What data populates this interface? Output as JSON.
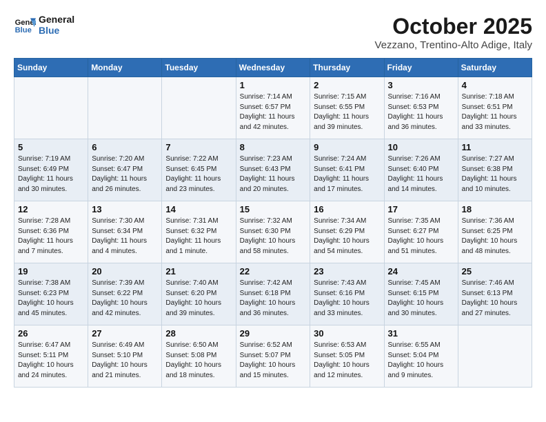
{
  "header": {
    "logo_line1": "General",
    "logo_line2": "Blue",
    "title": "October 2025",
    "subtitle": "Vezzano, Trentino-Alto Adige, Italy"
  },
  "days_of_week": [
    "Sunday",
    "Monday",
    "Tuesday",
    "Wednesday",
    "Thursday",
    "Friday",
    "Saturday"
  ],
  "weeks": [
    [
      {
        "num": "",
        "info": ""
      },
      {
        "num": "",
        "info": ""
      },
      {
        "num": "",
        "info": ""
      },
      {
        "num": "1",
        "info": "Sunrise: 7:14 AM\nSunset: 6:57 PM\nDaylight: 11 hours and 42 minutes."
      },
      {
        "num": "2",
        "info": "Sunrise: 7:15 AM\nSunset: 6:55 PM\nDaylight: 11 hours and 39 minutes."
      },
      {
        "num": "3",
        "info": "Sunrise: 7:16 AM\nSunset: 6:53 PM\nDaylight: 11 hours and 36 minutes."
      },
      {
        "num": "4",
        "info": "Sunrise: 7:18 AM\nSunset: 6:51 PM\nDaylight: 11 hours and 33 minutes."
      }
    ],
    [
      {
        "num": "5",
        "info": "Sunrise: 7:19 AM\nSunset: 6:49 PM\nDaylight: 11 hours and 30 minutes."
      },
      {
        "num": "6",
        "info": "Sunrise: 7:20 AM\nSunset: 6:47 PM\nDaylight: 11 hours and 26 minutes."
      },
      {
        "num": "7",
        "info": "Sunrise: 7:22 AM\nSunset: 6:45 PM\nDaylight: 11 hours and 23 minutes."
      },
      {
        "num": "8",
        "info": "Sunrise: 7:23 AM\nSunset: 6:43 PM\nDaylight: 11 hours and 20 minutes."
      },
      {
        "num": "9",
        "info": "Sunrise: 7:24 AM\nSunset: 6:41 PM\nDaylight: 11 hours and 17 minutes."
      },
      {
        "num": "10",
        "info": "Sunrise: 7:26 AM\nSunset: 6:40 PM\nDaylight: 11 hours and 14 minutes."
      },
      {
        "num": "11",
        "info": "Sunrise: 7:27 AM\nSunset: 6:38 PM\nDaylight: 11 hours and 10 minutes."
      }
    ],
    [
      {
        "num": "12",
        "info": "Sunrise: 7:28 AM\nSunset: 6:36 PM\nDaylight: 11 hours and 7 minutes."
      },
      {
        "num": "13",
        "info": "Sunrise: 7:30 AM\nSunset: 6:34 PM\nDaylight: 11 hours and 4 minutes."
      },
      {
        "num": "14",
        "info": "Sunrise: 7:31 AM\nSunset: 6:32 PM\nDaylight: 11 hours and 1 minute."
      },
      {
        "num": "15",
        "info": "Sunrise: 7:32 AM\nSunset: 6:30 PM\nDaylight: 10 hours and 58 minutes."
      },
      {
        "num": "16",
        "info": "Sunrise: 7:34 AM\nSunset: 6:29 PM\nDaylight: 10 hours and 54 minutes."
      },
      {
        "num": "17",
        "info": "Sunrise: 7:35 AM\nSunset: 6:27 PM\nDaylight: 10 hours and 51 minutes."
      },
      {
        "num": "18",
        "info": "Sunrise: 7:36 AM\nSunset: 6:25 PM\nDaylight: 10 hours and 48 minutes."
      }
    ],
    [
      {
        "num": "19",
        "info": "Sunrise: 7:38 AM\nSunset: 6:23 PM\nDaylight: 10 hours and 45 minutes."
      },
      {
        "num": "20",
        "info": "Sunrise: 7:39 AM\nSunset: 6:22 PM\nDaylight: 10 hours and 42 minutes."
      },
      {
        "num": "21",
        "info": "Sunrise: 7:40 AM\nSunset: 6:20 PM\nDaylight: 10 hours and 39 minutes."
      },
      {
        "num": "22",
        "info": "Sunrise: 7:42 AM\nSunset: 6:18 PM\nDaylight: 10 hours and 36 minutes."
      },
      {
        "num": "23",
        "info": "Sunrise: 7:43 AM\nSunset: 6:16 PM\nDaylight: 10 hours and 33 minutes."
      },
      {
        "num": "24",
        "info": "Sunrise: 7:45 AM\nSunset: 6:15 PM\nDaylight: 10 hours and 30 minutes."
      },
      {
        "num": "25",
        "info": "Sunrise: 7:46 AM\nSunset: 6:13 PM\nDaylight: 10 hours and 27 minutes."
      }
    ],
    [
      {
        "num": "26",
        "info": "Sunrise: 6:47 AM\nSunset: 5:11 PM\nDaylight: 10 hours and 24 minutes."
      },
      {
        "num": "27",
        "info": "Sunrise: 6:49 AM\nSunset: 5:10 PM\nDaylight: 10 hours and 21 minutes."
      },
      {
        "num": "28",
        "info": "Sunrise: 6:50 AM\nSunset: 5:08 PM\nDaylight: 10 hours and 18 minutes."
      },
      {
        "num": "29",
        "info": "Sunrise: 6:52 AM\nSunset: 5:07 PM\nDaylight: 10 hours and 15 minutes."
      },
      {
        "num": "30",
        "info": "Sunrise: 6:53 AM\nSunset: 5:05 PM\nDaylight: 10 hours and 12 minutes."
      },
      {
        "num": "31",
        "info": "Sunrise: 6:55 AM\nSunset: 5:04 PM\nDaylight: 10 hours and 9 minutes."
      },
      {
        "num": "",
        "info": ""
      }
    ]
  ]
}
